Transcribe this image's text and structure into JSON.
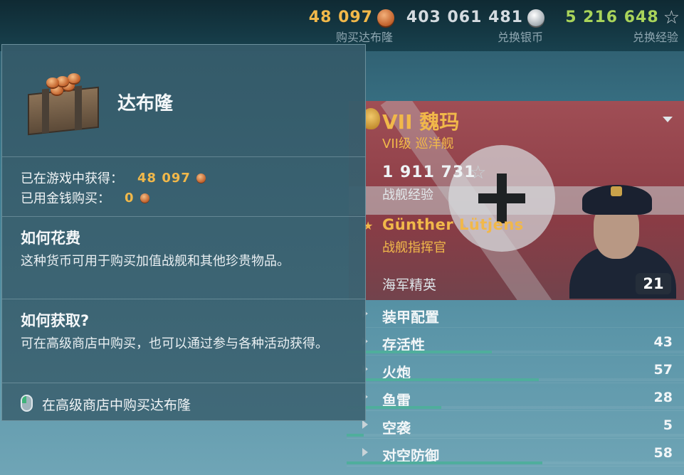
{
  "currencies": [
    {
      "amount": "48 097",
      "label": "购买达布隆",
      "icon": "doubloon-icon",
      "color": "#f1b84a"
    },
    {
      "amount": "403 061 481",
      "label": "兑换银币",
      "icon": "silver-coin-icon",
      "color": "#d4dbe0"
    },
    {
      "amount": "5 216 648",
      "label": "兑换经验",
      "icon": "star-icon",
      "color": "#a9d45a"
    }
  ],
  "tooltip": {
    "title": "达布隆",
    "earned_label": "已在游戏中获得：",
    "earned_value": "48 097",
    "bought_label": "已用金钱购买：",
    "bought_value": "0",
    "spend_heading": "如何花费",
    "spend_text": "这种货币可用于购买加值战舰和其他珍贵物品。",
    "obtain_heading": "如何获取?",
    "obtain_text": "可在高级商店中购买，也可以通过参与各种活动获得。",
    "action_text": "在高级商店中购买达布隆"
  },
  "ship": {
    "tier_name": "VII 魏玛",
    "class": "VII级 巡洋舰",
    "xp_value": "1 911 731",
    "xp_label": "战舰经验"
  },
  "commander": {
    "name": "Günther Lütjens",
    "title": "战舰指挥官",
    "level": "21",
    "elite_label": "海军精英"
  },
  "skills": [
    {
      "name": "装甲配置",
      "value": "",
      "bar": 0
    },
    {
      "name": "存活性",
      "value": "43",
      "bar": 0.43
    },
    {
      "name": "火炮",
      "value": "57",
      "bar": 0.57
    },
    {
      "name": "鱼雷",
      "value": "28",
      "bar": 0.28
    },
    {
      "name": "空袭",
      "value": "5",
      "bar": 0.05
    },
    {
      "name": "对空防御",
      "value": "58",
      "bar": 0.58
    }
  ]
}
